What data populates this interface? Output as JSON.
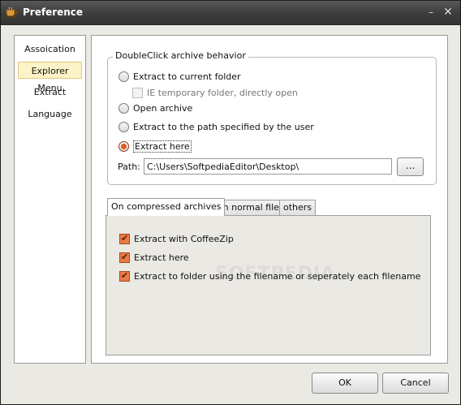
{
  "window": {
    "title": "Preference",
    "minimize_glyph": "–",
    "close_glyph": "✕"
  },
  "sidebar": {
    "items": [
      {
        "label": "Assoication",
        "selected": false
      },
      {
        "label": "Explorer Menu",
        "selected": true
      },
      {
        "label": "Extract",
        "selected": false
      },
      {
        "label": "Language",
        "selected": false
      }
    ]
  },
  "doubleclick": {
    "legend": "DoubleClick archive behavior",
    "options": [
      {
        "label": "Extract to current folder",
        "checked": false
      },
      {
        "label": "Open archive",
        "checked": false
      },
      {
        "label": "Extract to the path specified by the user",
        "checked": false
      },
      {
        "label": "Extract here",
        "checked": true
      }
    ],
    "ie_temp": {
      "label": "IE temporary folder, directly open",
      "checked": false,
      "disabled": true
    },
    "path_label": "Path:",
    "path_value": "C:\\Users\\SoftpediaEditor\\Desktop\\",
    "browse_label": "..."
  },
  "tabs": [
    {
      "label": "On compressed archives",
      "active": true
    },
    {
      "label": "On normal files",
      "active": false
    },
    {
      "label": "others",
      "active": false
    }
  ],
  "compressed_options": [
    {
      "label": "Extract with CoffeeZip",
      "checked": true
    },
    {
      "label": "Extract here",
      "checked": true
    },
    {
      "label": "Extract to folder using the filename or seperately each filename",
      "checked": true
    }
  ],
  "watermark": "SOFTPEDIA",
  "buttons": {
    "ok": "OK",
    "cancel": "Cancel"
  },
  "icons": {
    "app": "coffee-cup-icon",
    "minimize": "minimize-icon",
    "close": "close-icon"
  },
  "colors": {
    "accent": "#e15a1e",
    "selection": "#fdf3c8"
  }
}
